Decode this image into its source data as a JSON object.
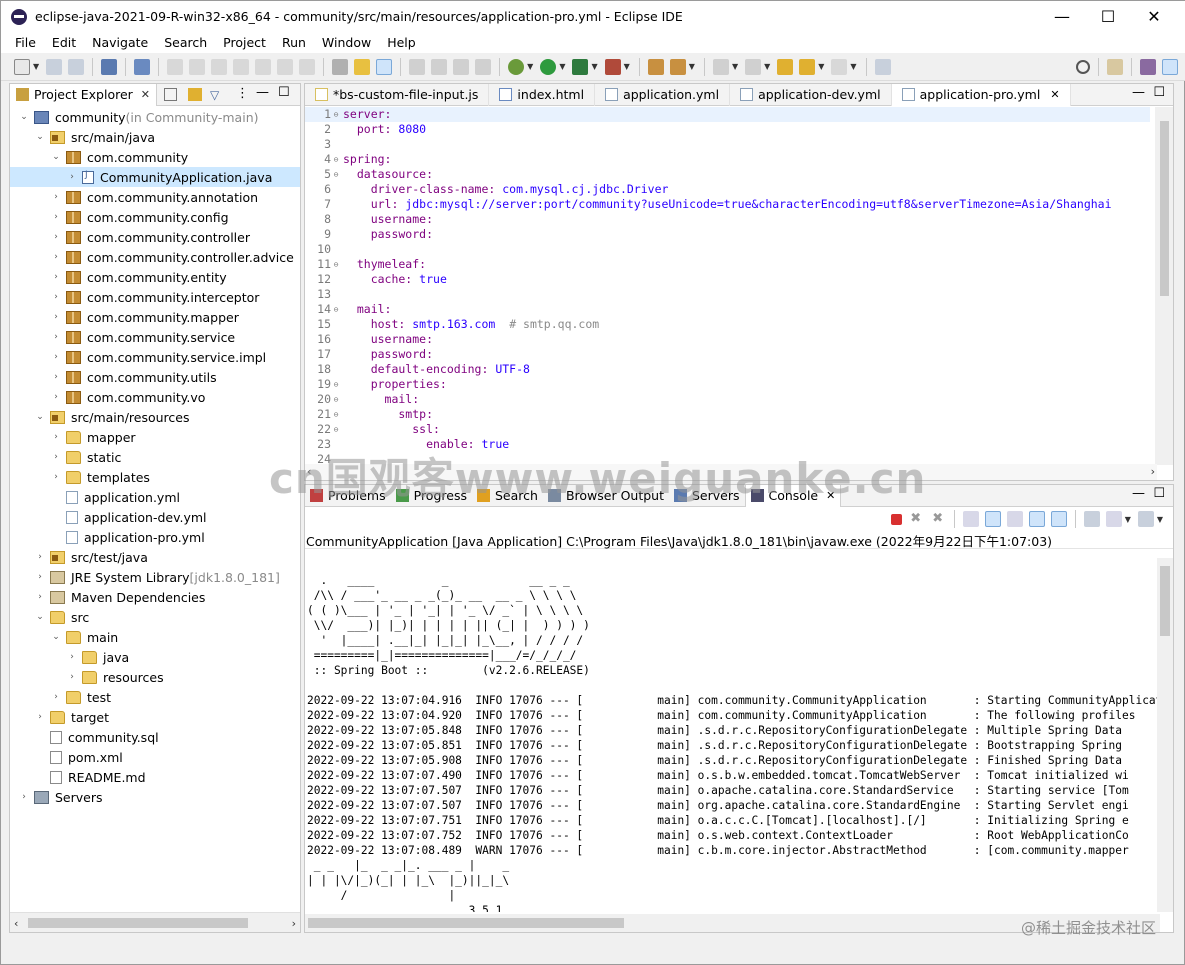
{
  "window": {
    "title": "eclipse-java-2021-09-R-win32-x86_64 - community/src/main/resources/application-pro.yml - Eclipse IDE",
    "minimize": "—",
    "maximize": "☐",
    "close": "✕"
  },
  "menu": [
    "File",
    "Edit",
    "Navigate",
    "Search",
    "Project",
    "Run",
    "Window",
    "Help"
  ],
  "explorer": {
    "tab_label": "Project Explorer",
    "close": "✕",
    "tree": [
      {
        "label": "community",
        "suffix": " (in Community-main)",
        "icon": "project-icon",
        "depth": 0,
        "arrow": "⌄"
      },
      {
        "label": "src/main/java",
        "icon": "source-folder-icon",
        "depth": 1,
        "arrow": "⌄"
      },
      {
        "label": "com.community",
        "icon": "package-icon",
        "depth": 2,
        "arrow": "⌄"
      },
      {
        "label": "CommunityApplication.java",
        "icon": "java-file-icon",
        "depth": 3,
        "arrow": "›",
        "selected": true
      },
      {
        "label": "com.community.annotation",
        "icon": "package-icon",
        "depth": 2,
        "arrow": "›"
      },
      {
        "label": "com.community.config",
        "icon": "package-icon",
        "depth": 2,
        "arrow": "›"
      },
      {
        "label": "com.community.controller",
        "icon": "package-icon",
        "depth": 2,
        "arrow": "›"
      },
      {
        "label": "com.community.controller.advice",
        "icon": "package-icon",
        "depth": 2,
        "arrow": "›"
      },
      {
        "label": "com.community.entity",
        "icon": "package-icon",
        "depth": 2,
        "arrow": "›"
      },
      {
        "label": "com.community.interceptor",
        "icon": "package-icon",
        "depth": 2,
        "arrow": "›"
      },
      {
        "label": "com.community.mapper",
        "icon": "package-icon",
        "depth": 2,
        "arrow": "›"
      },
      {
        "label": "com.community.service",
        "icon": "package-icon",
        "depth": 2,
        "arrow": "›"
      },
      {
        "label": "com.community.service.impl",
        "icon": "package-icon",
        "depth": 2,
        "arrow": "›"
      },
      {
        "label": "com.community.utils",
        "icon": "package-icon",
        "depth": 2,
        "arrow": "›"
      },
      {
        "label": "com.community.vo",
        "icon": "package-icon",
        "depth": 2,
        "arrow": "›"
      },
      {
        "label": "src/main/resources",
        "icon": "source-folder-icon",
        "depth": 1,
        "arrow": "⌄"
      },
      {
        "label": "mapper",
        "icon": "folder-icon",
        "depth": 2,
        "arrow": "›"
      },
      {
        "label": "static",
        "icon": "folder-icon",
        "depth": 2,
        "arrow": "›"
      },
      {
        "label": "templates",
        "icon": "folder-icon",
        "depth": 2,
        "arrow": "›"
      },
      {
        "label": "application.yml",
        "icon": "yml-file-icon",
        "depth": 2,
        "arrow": ""
      },
      {
        "label": "application-dev.yml",
        "icon": "yml-file-icon",
        "depth": 2,
        "arrow": ""
      },
      {
        "label": "application-pro.yml",
        "icon": "yml-file-icon",
        "depth": 2,
        "arrow": ""
      },
      {
        "label": "src/test/java",
        "icon": "source-folder-icon",
        "depth": 1,
        "arrow": "›"
      },
      {
        "label": "JRE System Library",
        "suffix": " [jdk1.8.0_181]",
        "icon": "library-icon",
        "depth": 1,
        "arrow": "›"
      },
      {
        "label": "Maven Dependencies",
        "icon": "library-icon",
        "depth": 1,
        "arrow": "›"
      },
      {
        "label": "src",
        "icon": "folder-icon",
        "depth": 1,
        "arrow": "⌄"
      },
      {
        "label": "main",
        "icon": "folder-icon",
        "depth": 2,
        "arrow": "⌄"
      },
      {
        "label": "java",
        "icon": "folder-icon",
        "depth": 3,
        "arrow": "›"
      },
      {
        "label": "resources",
        "icon": "folder-icon",
        "depth": 3,
        "arrow": "›"
      },
      {
        "label": "test",
        "icon": "folder-icon",
        "depth": 2,
        "arrow": "›"
      },
      {
        "label": "target",
        "icon": "folder-icon",
        "depth": 1,
        "arrow": "›"
      },
      {
        "label": "community.sql",
        "icon": "file-icon",
        "depth": 1,
        "arrow": ""
      },
      {
        "label": "pom.xml",
        "icon": "file-icon",
        "depth": 1,
        "arrow": ""
      },
      {
        "label": "README.md",
        "icon": "file-icon",
        "depth": 1,
        "arrow": ""
      },
      {
        "label": "Servers",
        "icon": "servers-icon",
        "depth": 0,
        "arrow": "›"
      }
    ]
  },
  "editor": {
    "tabs": [
      {
        "label": "*bs-custom-file-input.js",
        "icon": "js-file-icon"
      },
      {
        "label": "index.html",
        "icon": "html-file-icon"
      },
      {
        "label": "application.yml",
        "icon": "yml-file-icon"
      },
      {
        "label": "application-dev.yml",
        "icon": "yml-file-icon"
      },
      {
        "label": "application-pro.yml",
        "icon": "yml-file-icon",
        "active": true,
        "close": "✕"
      }
    ],
    "lines": [
      {
        "n": "1",
        "fold": "⊖",
        "parts": [
          [
            "k",
            "server:"
          ]
        ]
      },
      {
        "n": "2",
        "fold": "",
        "parts": [
          [
            "k",
            "  port: "
          ],
          [
            "vl",
            "8080"
          ]
        ]
      },
      {
        "n": "3",
        "fold": "",
        "parts": []
      },
      {
        "n": "4",
        "fold": "⊖",
        "parts": [
          [
            "k",
            "spring:"
          ]
        ]
      },
      {
        "n": "5",
        "fold": "⊖",
        "parts": [
          [
            "k",
            "  datasource:"
          ]
        ]
      },
      {
        "n": "6",
        "fold": "",
        "parts": [
          [
            "k",
            "    driver-class-name: "
          ],
          [
            "vl",
            "com.mysql.cj.jdbc.Driver"
          ]
        ]
      },
      {
        "n": "7",
        "fold": "",
        "parts": [
          [
            "k",
            "    url: "
          ],
          [
            "vl",
            "jdbc:mysql://server:port/community?useUnicode=true&characterEncoding=utf8&serverTimezone=Asia/Shanghai"
          ]
        ]
      },
      {
        "n": "8",
        "fold": "",
        "parts": [
          [
            "k",
            "    username:"
          ]
        ]
      },
      {
        "n": "9",
        "fold": "",
        "parts": [
          [
            "k",
            "    password:"
          ]
        ]
      },
      {
        "n": "10",
        "fold": "",
        "parts": []
      },
      {
        "n": "11",
        "fold": "⊖",
        "parts": [
          [
            "k",
            "  thymeleaf:"
          ]
        ]
      },
      {
        "n": "12",
        "fold": "",
        "parts": [
          [
            "k",
            "    cache: "
          ],
          [
            "vl",
            "true"
          ]
        ]
      },
      {
        "n": "13",
        "fold": "",
        "parts": []
      },
      {
        "n": "14",
        "fold": "⊖",
        "parts": [
          [
            "k",
            "  mail:"
          ]
        ]
      },
      {
        "n": "15",
        "fold": "",
        "parts": [
          [
            "k",
            "    host: "
          ],
          [
            "vl",
            "smtp.163.com"
          ],
          [
            "cm",
            "  # smtp.qq.com"
          ]
        ]
      },
      {
        "n": "16",
        "fold": "",
        "parts": [
          [
            "k",
            "    username:"
          ]
        ]
      },
      {
        "n": "17",
        "fold": "",
        "parts": [
          [
            "k",
            "    password:"
          ]
        ]
      },
      {
        "n": "18",
        "fold": "",
        "parts": [
          [
            "k",
            "    default-encoding: "
          ],
          [
            "vl",
            "UTF-8"
          ]
        ]
      },
      {
        "n": "19",
        "fold": "⊖",
        "parts": [
          [
            "k",
            "    properties:"
          ]
        ]
      },
      {
        "n": "20",
        "fold": "⊖",
        "parts": [
          [
            "k",
            "      mail:"
          ]
        ]
      },
      {
        "n": "21",
        "fold": "⊖",
        "parts": [
          [
            "k",
            "        smtp:"
          ]
        ]
      },
      {
        "n": "22",
        "fold": "⊖",
        "parts": [
          [
            "k",
            "          ssl:"
          ]
        ]
      },
      {
        "n": "23",
        "fold": "",
        "parts": [
          [
            "k",
            "            enable: "
          ],
          [
            "vl",
            "true"
          ]
        ]
      },
      {
        "n": "24",
        "fold": "",
        "parts": []
      }
    ]
  },
  "console_view": {
    "tabs": [
      {
        "label": "Problems",
        "icon": "problems-icon"
      },
      {
        "label": "Progress",
        "icon": "progress-icon"
      },
      {
        "label": "Search",
        "icon": "search-icon"
      },
      {
        "label": "Browser Output",
        "icon": "browser-output-icon"
      },
      {
        "label": "Servers",
        "icon": "servers-icon"
      },
      {
        "label": "Console",
        "icon": "console-icon",
        "active": true,
        "close": "✕"
      }
    ],
    "description": "CommunityApplication [Java Application] C:\\Program Files\\Java\\jdk1.8.0_181\\bin\\javaw.exe  (2022年9月22日下午1:07:03)",
    "output": [
      "",
      "  .   ____          _            __ _ _",
      " /\\\\ / ___'_ __ _ _(_)_ __  __ _ \\ \\ \\ \\",
      "( ( )\\___ | '_ | '_| | '_ \\/ _` | \\ \\ \\ \\",
      " \\\\/  ___)| |_)| | | | | || (_| |  ) ) ) )",
      "  '  |____| .__|_| |_|_| |_\\__, | / / / /",
      " =========|_|==============|___/=/_/_/_/",
      " :: Spring Boot ::        (v2.2.6.RELEASE)",
      "",
      "2022-09-22 13:07:04.916  INFO 17076 --- [           main] com.community.CommunityApplication       : Starting CommunityApplication",
      "2022-09-22 13:07:04.920  INFO 17076 --- [           main] com.community.CommunityApplication       : The following profiles",
      "2022-09-22 13:07:05.848  INFO 17076 --- [           main] .s.d.r.c.RepositoryConfigurationDelegate : Multiple Spring Data",
      "2022-09-22 13:07:05.851  INFO 17076 --- [           main] .s.d.r.c.RepositoryConfigurationDelegate : Bootstrapping Spring",
      "2022-09-22 13:07:05.908  INFO 17076 --- [           main] .s.d.r.c.RepositoryConfigurationDelegate : Finished Spring Data",
      "2022-09-22 13:07:07.490  INFO 17076 --- [           main] o.s.b.w.embedded.tomcat.TomcatWebServer  : Tomcat initialized wi",
      "2022-09-22 13:07:07.507  INFO 17076 --- [           main] o.apache.catalina.core.StandardService   : Starting service [Tom",
      "2022-09-22 13:07:07.507  INFO 17076 --- [           main] org.apache.catalina.core.StandardEngine  : Starting Servlet engi",
      "2022-09-22 13:07:07.751  INFO 17076 --- [           main] o.a.c.c.C.[Tomcat].[localhost].[/]       : Initializing Spring e",
      "2022-09-22 13:07:07.752  INFO 17076 --- [           main] o.s.web.context.ContextLoader            : Root WebApplicationCo",
      "2022-09-22 13:07:08.489  WARN 17076 --- [           main] c.b.m.core.injector.AbstractMethod       : [com.community.mapper",
      " _ _   |_  _ _|_. ___ _ |    _",
      "| | |\\/|_)(_| | |_\\  |_)||_|_\\",
      "     /               |",
      "                        3.5.1"
    ]
  },
  "watermarks": {
    "main": "cn国观客www.weiguanke.cn",
    "corner": "@稀土掘金技术社区"
  }
}
